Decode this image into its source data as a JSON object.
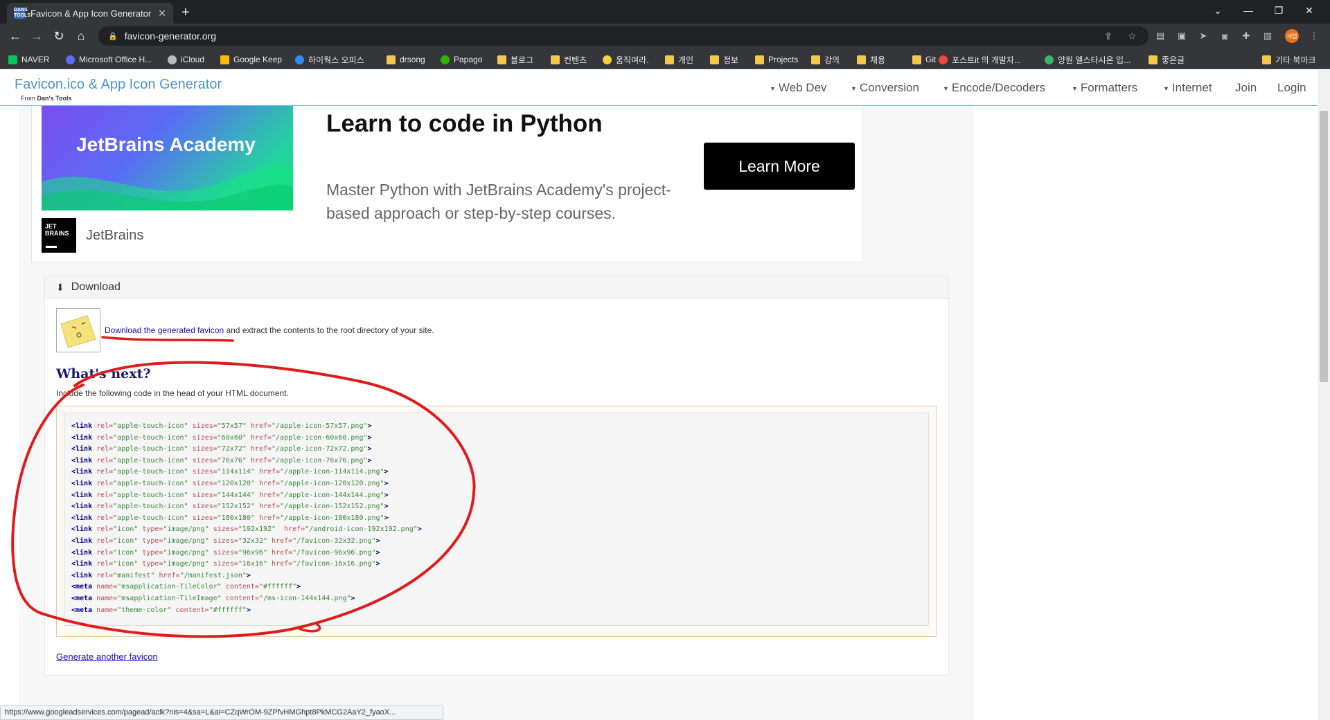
{
  "browser": {
    "tab_title": "Favicon & App Icon Generator",
    "tab_favicon_text": "DANS TOOLS",
    "url": "favicon-generator.org",
    "profile_label": "새탭",
    "bookmarks": [
      {
        "label": "NAVER",
        "icon": "naver-icon",
        "color": "#03c75a"
      },
      {
        "label": "Microsoft Office H...",
        "icon": "office-icon",
        "color": "#5b6cf5"
      },
      {
        "label": "iCloud",
        "icon": "apple-icon",
        "color": "#bbbbbb"
      },
      {
        "label": "Google Keep",
        "icon": "keep-icon",
        "color": "#fbbc04"
      },
      {
        "label": "하이웍스 오피스",
        "icon": "hiworks-icon",
        "color": "#2d8cf0"
      },
      {
        "label": "drsong",
        "icon": "folder-icon",
        "color": "#f2c94c"
      },
      {
        "label": "Papago",
        "icon": "papago-icon",
        "color": "#2db400"
      },
      {
        "label": "블로그",
        "icon": "folder-icon",
        "color": "#f2c94c"
      },
      {
        "label": "컨텐츠",
        "icon": "folder-icon",
        "color": "#f2c94c"
      },
      {
        "label": "움직여라.",
        "icon": "bulb-icon",
        "color": "#f4d03f"
      },
      {
        "label": "개인",
        "icon": "folder-icon",
        "color": "#f2c94c"
      },
      {
        "label": "정보",
        "icon": "folder-icon",
        "color": "#f2c94c"
      },
      {
        "label": "Projects",
        "icon": "folder-icon",
        "color": "#f2c94c"
      },
      {
        "label": "강의",
        "icon": "folder-icon",
        "color": "#f2c94c"
      },
      {
        "label": "채용",
        "icon": "folder-icon",
        "color": "#f2c94c"
      },
      {
        "label": "Git",
        "icon": "folder-icon",
        "color": "#f2c94c"
      },
      {
        "label": "포스트it 의 개발자...",
        "icon": "tistory-icon",
        "color": "#e8493b"
      },
      {
        "label": "양원 엘스타시온 입...",
        "icon": "leaf-icon",
        "color": "#3cb371"
      },
      {
        "label": "좋은글",
        "icon": "folder-icon",
        "color": "#f2c94c"
      }
    ],
    "other_bookmarks": "기타 북마크",
    "status_url": "https://www.googleadservices.com/pagead/aclk?nis=4&sa=L&ai=CZqWrOM-9ZPfvHMGhpt8PkMCG2AaY2_fyaoX..."
  },
  "site": {
    "brand": "Favicon.ico & App Icon Generator",
    "brand_sub_prefix": "From ",
    "brand_sub_name": "Dan's Tools",
    "nav": [
      "Web Dev",
      "Conversion",
      "Encode/Decoders",
      "Formatters",
      "Internet"
    ],
    "join": "Join",
    "login": "Login"
  },
  "ad": {
    "image_text": "JetBrains Academy",
    "logo_text": "JET BRAINS",
    "brand": "JetBrains",
    "title": "Learn to code in Python",
    "description": "Master Python with JetBrains Academy's project-based approach or step-by-step courses.",
    "button": "Learn More"
  },
  "download": {
    "heading": "Download",
    "link_text": "Download the generated favicon",
    "link_suffix": " and extract the contents to the root directory of your site.",
    "next_title": "What's next?",
    "next_desc": "Include the following code in the head of your HTML document.",
    "code_lines": [
      [
        [
          "tg",
          "<link "
        ],
        [
          "at",
          "rel="
        ],
        [
          "vl",
          "\"apple-touch-icon\" "
        ],
        [
          "at",
          "sizes="
        ],
        [
          "vl",
          "\"57x57\" "
        ],
        [
          "at",
          "href="
        ],
        [
          "vl",
          "\"/apple-icon-57x57.png\""
        ],
        [
          "tg",
          ">"
        ]
      ],
      [
        [
          "tg",
          "<link "
        ],
        [
          "at",
          "rel="
        ],
        [
          "vl",
          "\"apple-touch-icon\" "
        ],
        [
          "at",
          "sizes="
        ],
        [
          "vl",
          "\"60x60\" "
        ],
        [
          "at",
          "href="
        ],
        [
          "vl",
          "\"/apple-icon-60x60.png\""
        ],
        [
          "tg",
          ">"
        ]
      ],
      [
        [
          "tg",
          "<link "
        ],
        [
          "at",
          "rel="
        ],
        [
          "vl",
          "\"apple-touch-icon\" "
        ],
        [
          "at",
          "sizes="
        ],
        [
          "vl",
          "\"72x72\" "
        ],
        [
          "at",
          "href="
        ],
        [
          "vl",
          "\"/apple-icon-72x72.png\""
        ],
        [
          "tg",
          ">"
        ]
      ],
      [
        [
          "tg",
          "<link "
        ],
        [
          "at",
          "rel="
        ],
        [
          "vl",
          "\"apple-touch-icon\" "
        ],
        [
          "at",
          "sizes="
        ],
        [
          "vl",
          "\"76x76\" "
        ],
        [
          "at",
          "href="
        ],
        [
          "vl",
          "\"/apple-icon-76x76.png\""
        ],
        [
          "tg",
          ">"
        ]
      ],
      [
        [
          "tg",
          "<link "
        ],
        [
          "at",
          "rel="
        ],
        [
          "vl",
          "\"apple-touch-icon\" "
        ],
        [
          "at",
          "sizes="
        ],
        [
          "vl",
          "\"114x114\" "
        ],
        [
          "at",
          "href="
        ],
        [
          "vl",
          "\"/apple-icon-114x114.png\""
        ],
        [
          "tg",
          ">"
        ]
      ],
      [
        [
          "tg",
          "<link "
        ],
        [
          "at",
          "rel="
        ],
        [
          "vl",
          "\"apple-touch-icon\" "
        ],
        [
          "at",
          "sizes="
        ],
        [
          "vl",
          "\"120x120\" "
        ],
        [
          "at",
          "href="
        ],
        [
          "vl",
          "\"/apple-icon-120x120.png\""
        ],
        [
          "tg",
          ">"
        ]
      ],
      [
        [
          "tg",
          "<link "
        ],
        [
          "at",
          "rel="
        ],
        [
          "vl",
          "\"apple-touch-icon\" "
        ],
        [
          "at",
          "sizes="
        ],
        [
          "vl",
          "\"144x144\" "
        ],
        [
          "at",
          "href="
        ],
        [
          "vl",
          "\"/apple-icon-144x144.png\""
        ],
        [
          "tg",
          ">"
        ]
      ],
      [
        [
          "tg",
          "<link "
        ],
        [
          "at",
          "rel="
        ],
        [
          "vl",
          "\"apple-touch-icon\" "
        ],
        [
          "at",
          "sizes="
        ],
        [
          "vl",
          "\"152x152\" "
        ],
        [
          "at",
          "href="
        ],
        [
          "vl",
          "\"/apple-icon-152x152.png\""
        ],
        [
          "tg",
          ">"
        ]
      ],
      [
        [
          "tg",
          "<link "
        ],
        [
          "at",
          "rel="
        ],
        [
          "vl",
          "\"apple-touch-icon\" "
        ],
        [
          "at",
          "sizes="
        ],
        [
          "vl",
          "\"180x180\" "
        ],
        [
          "at",
          "href="
        ],
        [
          "vl",
          "\"/apple-icon-180x180.png\""
        ],
        [
          "tg",
          ">"
        ]
      ],
      [
        [
          "tg",
          "<link "
        ],
        [
          "at",
          "rel="
        ],
        [
          "vl",
          "\"icon\" "
        ],
        [
          "at",
          "type="
        ],
        [
          "vl",
          "\"image/png\" "
        ],
        [
          "at",
          "sizes="
        ],
        [
          "vl",
          "\"192x192\"  "
        ],
        [
          "at",
          "href="
        ],
        [
          "vl",
          "\"/android-icon-192x192.png\""
        ],
        [
          "tg",
          ">"
        ]
      ],
      [
        [
          "tg",
          "<link "
        ],
        [
          "at",
          "rel="
        ],
        [
          "vl",
          "\"icon\" "
        ],
        [
          "at",
          "type="
        ],
        [
          "vl",
          "\"image/png\" "
        ],
        [
          "at",
          "sizes="
        ],
        [
          "vl",
          "\"32x32\" "
        ],
        [
          "at",
          "href="
        ],
        [
          "vl",
          "\"/favicon-32x32.png\""
        ],
        [
          "tg",
          ">"
        ]
      ],
      [
        [
          "tg",
          "<link "
        ],
        [
          "at",
          "rel="
        ],
        [
          "vl",
          "\"icon\" "
        ],
        [
          "at",
          "type="
        ],
        [
          "vl",
          "\"image/png\" "
        ],
        [
          "at",
          "sizes="
        ],
        [
          "vl",
          "\"96x96\" "
        ],
        [
          "at",
          "href="
        ],
        [
          "vl",
          "\"/favicon-96x96.png\""
        ],
        [
          "tg",
          ">"
        ]
      ],
      [
        [
          "tg",
          "<link "
        ],
        [
          "at",
          "rel="
        ],
        [
          "vl",
          "\"icon\" "
        ],
        [
          "at",
          "type="
        ],
        [
          "vl",
          "\"image/png\" "
        ],
        [
          "at",
          "sizes="
        ],
        [
          "vl",
          "\"16x16\" "
        ],
        [
          "at",
          "href="
        ],
        [
          "vl",
          "\"/favicon-16x16.png\""
        ],
        [
          "tg",
          ">"
        ]
      ],
      [
        [
          "tg",
          "<link "
        ],
        [
          "at",
          "rel="
        ],
        [
          "vl",
          "\"manifest\" "
        ],
        [
          "at",
          "href="
        ],
        [
          "vl",
          "\"/manifest.json\""
        ],
        [
          "tg",
          ">"
        ]
      ],
      [
        [
          "tg",
          "<meta "
        ],
        [
          "at",
          "name="
        ],
        [
          "vl",
          "\"msapplication-TileColor\" "
        ],
        [
          "at",
          "content="
        ],
        [
          "vl",
          "\"#ffffff\""
        ],
        [
          "tg",
          ">"
        ]
      ],
      [
        [
          "tg",
          "<meta "
        ],
        [
          "at",
          "name="
        ],
        [
          "vl",
          "\"msapplication-TileImage\" "
        ],
        [
          "at",
          "content="
        ],
        [
          "vl",
          "\"/ms-icon-144x144.png\""
        ],
        [
          "tg",
          ">"
        ]
      ],
      [
        [
          "tg",
          "<meta "
        ],
        [
          "at",
          "name="
        ],
        [
          "vl",
          "\"theme-color\" "
        ],
        [
          "at",
          "content="
        ],
        [
          "vl",
          "\"#ffffff\""
        ],
        [
          "tg",
          ">"
        ]
      ]
    ],
    "generate_another": "Generate another favicon"
  },
  "colors": {
    "annotation": "#e01b1b",
    "brand": "#4b96c9",
    "link": "#1a0dab"
  }
}
